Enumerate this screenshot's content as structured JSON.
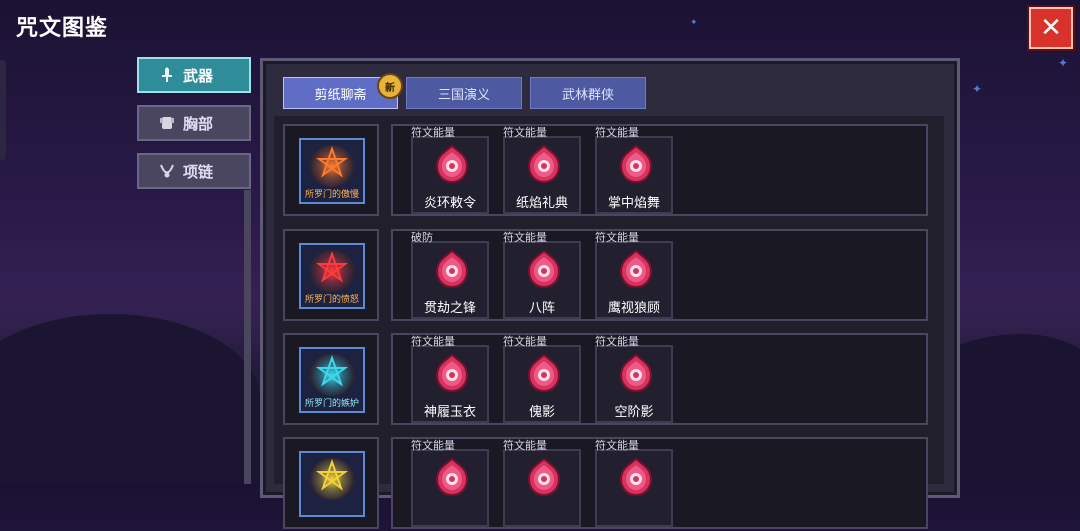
{
  "header": {
    "title": "咒文图鉴",
    "close_label": "✕"
  },
  "side_tabs": [
    {
      "label": "武器",
      "icon": "sword-icon",
      "active": true
    },
    {
      "label": "胸部",
      "icon": "chest-armor-icon",
      "active": false
    },
    {
      "label": "项链",
      "icon": "necklace-icon",
      "active": false
    }
  ],
  "sub_tabs": [
    {
      "label": "剪纸聊斋",
      "active": true,
      "badge": "新"
    },
    {
      "label": "三国演义",
      "active": false
    },
    {
      "label": "武林群侠",
      "active": false
    }
  ],
  "rows": [
    {
      "head_label": "所罗门的傲慢",
      "head_color": "#ff7a2a",
      "head_icon": "pride-sigil-icon",
      "cards": [
        {
          "type": "符文能量",
          "name": "炎环敕令",
          "icon": "flame-ring-rune-icon"
        },
        {
          "type": "符文能量",
          "name": "纸焰礼典",
          "icon": "paper-flame-rune-icon"
        },
        {
          "type": "符文能量",
          "name": "掌中焰舞",
          "icon": "palm-flame-rune-icon"
        }
      ]
    },
    {
      "head_label": "所罗门的愤怒",
      "head_color": "#ff3b3b",
      "head_icon": "wrath-sigil-icon",
      "cards": [
        {
          "type": "破防",
          "name": "贯劫之锋",
          "icon": "piercing-edge-rune-icon"
        },
        {
          "type": "符文能量",
          "name": "八阵",
          "icon": "eight-formation-rune-icon"
        },
        {
          "type": "符文能量",
          "name": "鹰视狼顾",
          "icon": "hawk-gaze-rune-icon"
        }
      ]
    },
    {
      "head_label": "所罗门的嫉妒",
      "head_color": "#3fd8e8",
      "head_icon": "envy-sigil-icon",
      "cards": [
        {
          "type": "符文能量",
          "name": "神履玉衣",
          "icon": "jade-robe-rune-icon"
        },
        {
          "type": "符文能量",
          "name": "傀影",
          "icon": "puppet-shadow-rune-icon"
        },
        {
          "type": "符文能量",
          "name": "空阶影",
          "icon": "void-step-rune-icon"
        }
      ]
    },
    {
      "head_label": "",
      "head_color": "#f2d23a",
      "head_icon": "sigil-icon",
      "cards": [
        {
          "type": "符文能量",
          "name": "",
          "icon": "rune-icon"
        },
        {
          "type": "符文能量",
          "name": "",
          "icon": "rune-icon"
        },
        {
          "type": "符文能量",
          "name": "",
          "icon": "rune-icon"
        }
      ]
    }
  ],
  "colors": {
    "accent_teal": "#2f8d9a",
    "close_red": "#d8322b",
    "rune_pink": "#e23a6e",
    "subtab_blue": "#4d59a0"
  }
}
